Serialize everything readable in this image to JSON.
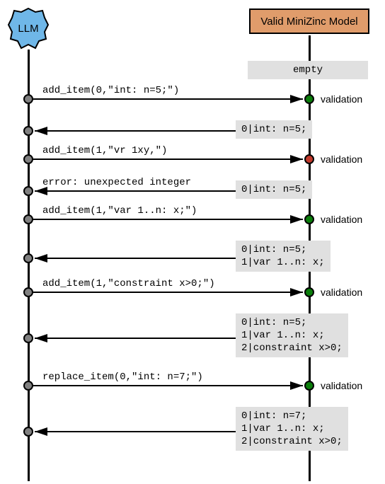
{
  "actors": {
    "left": "LLM",
    "right": "Valid MiniZinc Model"
  },
  "states": {
    "s0": "empty",
    "s1": "0|int: n=5;",
    "s2": "0|int: n=5;",
    "s3": "0|int: n=5;\n1|var 1..n: x;",
    "s4": "0|int: n=5;\n1|var 1..n: x;\n2|constraint x>0;",
    "s5": "0|int: n=7;\n1|var 1..n: x;\n2|constraint x>0;"
  },
  "messages": {
    "m1": "add_item(0,\"int: n=5;\")",
    "m2": "add_item(1,\"vr 1xy,\")",
    "m3": "error: unexpected integer",
    "m4": "add_item(1,\"var 1..n: x;\")",
    "m5": "add_item(1,\"constraint x>0;\")",
    "m6": "replace_item(0,\"int: n=7;\")"
  },
  "validation_label": "validation",
  "colors": {
    "llm_fill": "#6fb7e8",
    "model_fill": "#e09c6b",
    "state_fill": "#e0e0e0",
    "dot_grey": "#808080",
    "dot_green": "#0a7d0a",
    "dot_red": "#c0392b"
  }
}
